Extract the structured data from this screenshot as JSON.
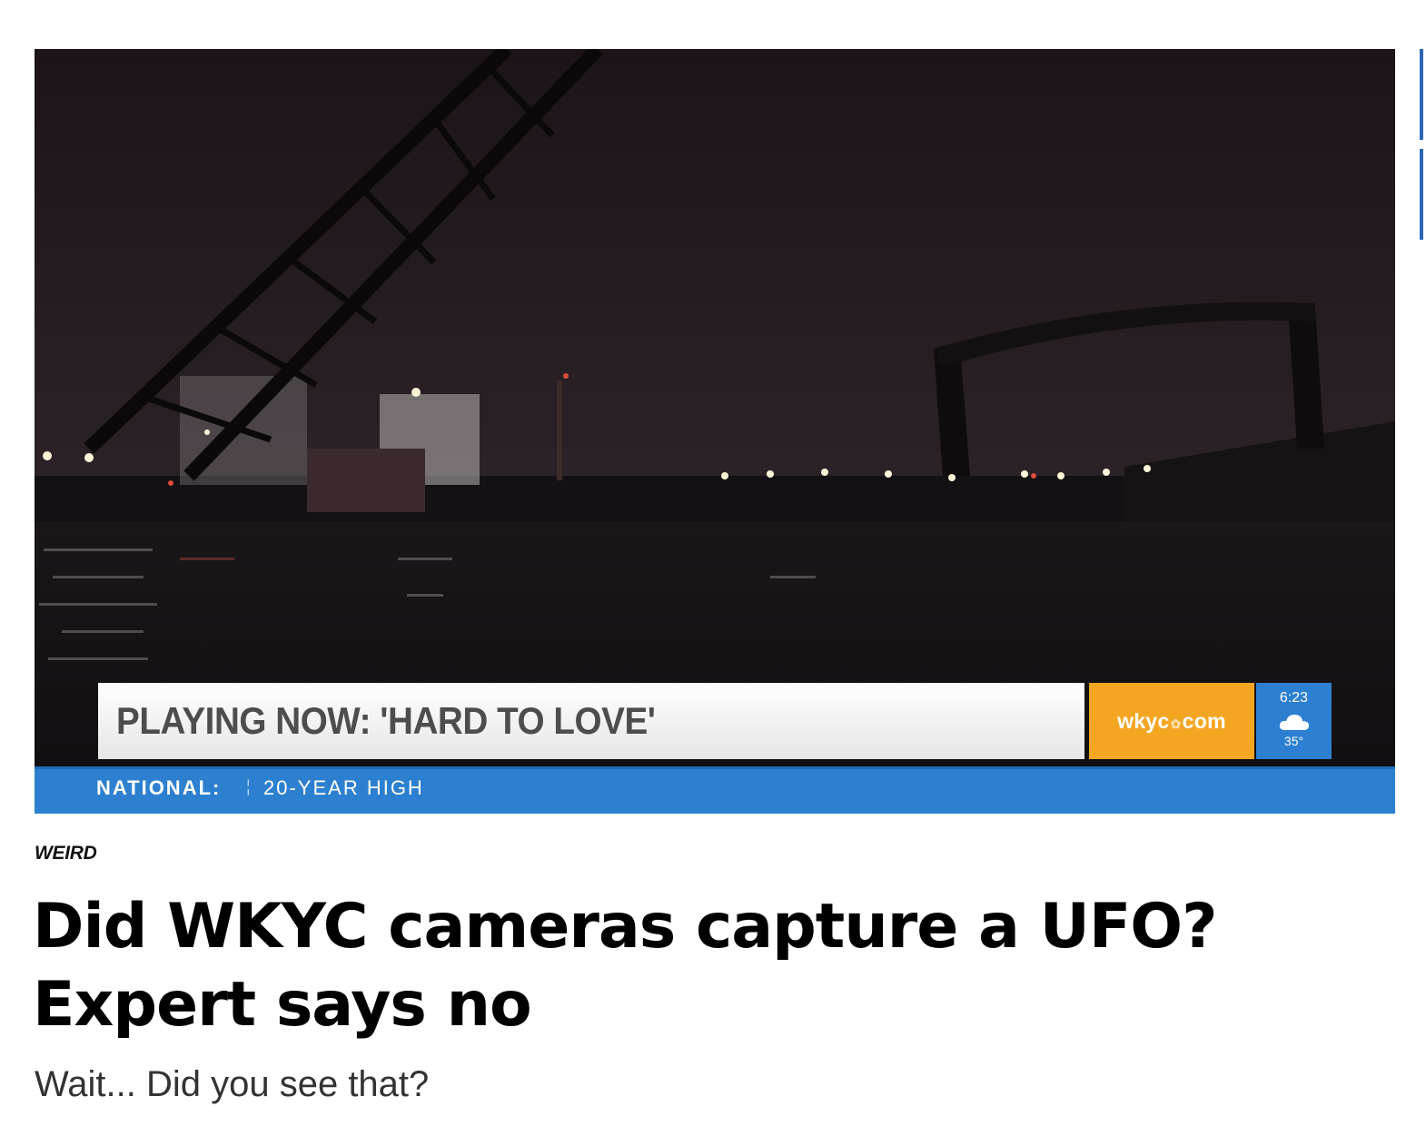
{
  "video": {
    "lower_third": {
      "headline": "PLAYING NOW: 'HARD TO LOVE'",
      "brand": {
        "prefix": "wkyc",
        "suffix": "com",
        "logo": "peacock-icon"
      },
      "weather": {
        "time": "6:23",
        "icon": "cloud-icon",
        "temperature": "35°"
      }
    },
    "ticker": {
      "label": "NATIONAL:",
      "text": "20-YEAR HIGH"
    }
  },
  "article": {
    "category": "WEIRD",
    "title": "Did WKYC cameras capture a UFO? Expert says no",
    "subtitle": "Wait... Did you see that?"
  },
  "colors": {
    "ticker_blue": "#2d80cf",
    "brand_orange": "#f4a623",
    "weather_blue": "#2c7fd1",
    "night_sky": "#1e1619"
  }
}
